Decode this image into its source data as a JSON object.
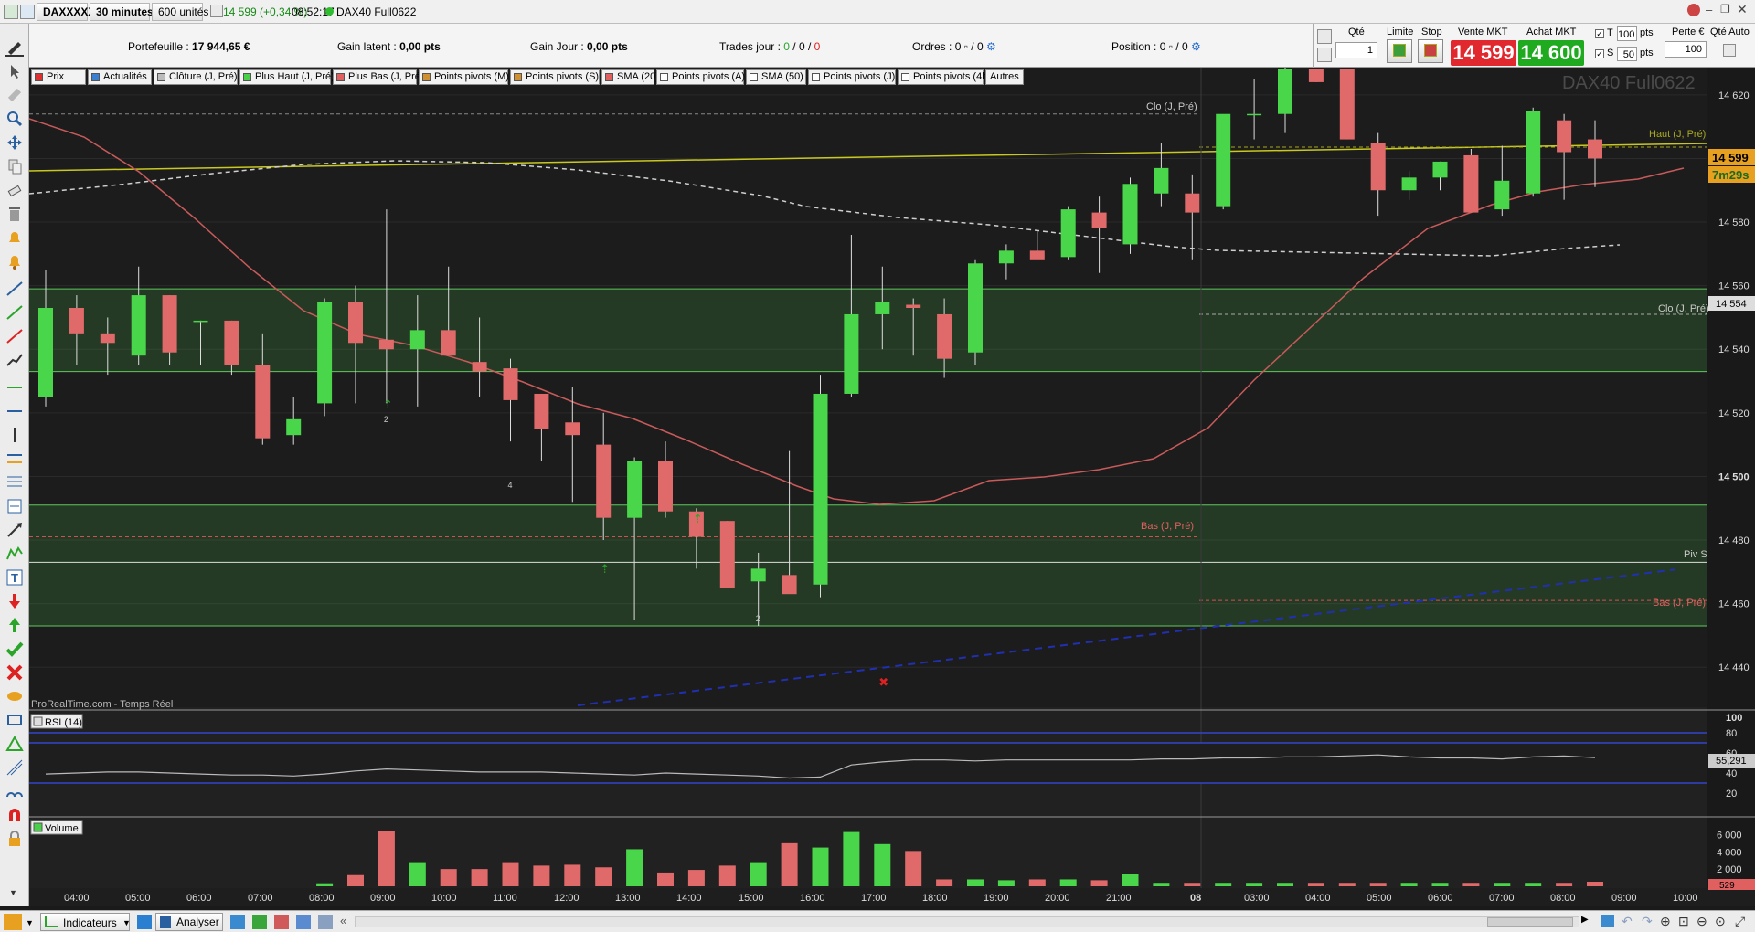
{
  "topbar": {
    "instrument": "DAXXXXX",
    "timeframe": "30 minutes",
    "units": "600 unités",
    "quote": "14 599 (+0,34 %)",
    "time": "08:52:17",
    "title": "DAX40 Full0622"
  },
  "infobar": {
    "portfolio_label": "Portefeuille :",
    "portfolio_value": "17 944,65 €",
    "gain_latent_label": "Gain latent :",
    "gain_latent_value": "0,00 pts",
    "gain_jour_label": "Gain Jour :",
    "gain_jour_value": "0,00 pts",
    "trades_label": "Trades jour :",
    "trades_a": "0",
    "trades_b": "0",
    "trades_c": "0",
    "ordres_label": "Ordres :",
    "ordres_a": "0",
    "ordres_b": "0",
    "position_label": "Position :",
    "position_a": "0",
    "position_b": "0"
  },
  "orderpanel": {
    "qte_label": "Qté",
    "qte_value": "1",
    "limite_label": "Limite",
    "stop_label": "Stop",
    "vente_label": "Vente MKT",
    "vente_price": "14 599",
    "achat_label": "Achat MKT",
    "achat_price": "14 600",
    "t_label": "T",
    "t_value": "100",
    "t_unit": "pts",
    "s_label": "S",
    "s_value": "50",
    "s_unit": "pts",
    "perte_label": "Perte €",
    "perte_value": "100",
    "qte_auto_label": "Qté Auto"
  },
  "chips": [
    {
      "label": "Prix",
      "color": "#e03030"
    },
    {
      "label": "Actualités",
      "color": "#3a7fd0"
    },
    {
      "label": "Clôture (J, Pré)",
      "color": "#bbbbbb"
    },
    {
      "label": "Plus Haut (J, Pré)",
      "color": "#49d049"
    },
    {
      "label": "Plus Bas (J, Pré)",
      "color": "#e06060"
    },
    {
      "label": "Points pivots (M)",
      "color": "#d09030"
    },
    {
      "label": "Points pivots (S)",
      "color": "#d09030"
    },
    {
      "label": "SMA (20)",
      "color": "#e06060"
    },
    {
      "label": "Points pivots (A)",
      "color": "#ffffff"
    },
    {
      "label": "SMA (50)",
      "color": "#ffffff"
    },
    {
      "label": "Points pivots (J)",
      "color": "#ffffff"
    },
    {
      "label": "Points pivots (4h)",
      "color": "#ffffff"
    },
    {
      "label": "Autres",
      "color": ""
    }
  ],
  "chart": {
    "watermark": "DAX40 Full0622",
    "source": "ProRealTime.com - Temps Réel",
    "price_ticks": [
      "14 620",
      "14 600",
      "14 580",
      "14 560",
      "14 540",
      "14 520",
      "14 500",
      "14 480",
      "14 460",
      "14 440"
    ],
    "current_price": "14 599",
    "countdown": "7m29s",
    "price_tag_2": "14 554",
    "line_labels": {
      "clo_top": "Clo (J, Pré)",
      "haut": "Haut (J, Pré)",
      "clo_right": "Clo (J, Pré)",
      "bas_mid": "Bas (J, Pré)",
      "piv": "Piv S",
      "bas_right": "Bas (J, Pré)"
    },
    "time_ticks": [
      "04:00",
      "05:00",
      "06:00",
      "07:00",
      "08:00",
      "09:00",
      "10:00",
      "11:00",
      "12:00",
      "13:00",
      "14:00",
      "15:00",
      "16:00",
      "17:00",
      "18:00",
      "19:00",
      "20:00",
      "21:00",
      "08",
      "03:00",
      "04:00",
      "05:00",
      "06:00",
      "07:00",
      "08:00",
      "09:00",
      "10:00"
    ],
    "markers": [
      "2",
      "4",
      "2"
    ]
  },
  "rsi": {
    "label": "RSI (14)",
    "ticks": [
      "100",
      "80",
      "60",
      "40",
      "20"
    ],
    "value": "55,291"
  },
  "volume": {
    "label": "Volume",
    "ticks": [
      "6 000",
      "4 000",
      "2 000"
    ],
    "last": "529"
  },
  "chart_data": {
    "type": "candlestick",
    "title": "DAX40 Full0622",
    "timeframe": "30 minutes",
    "ylim": [
      14425,
      14625
    ],
    "candles": [
      {
        "o": 14525,
        "h": 14565,
        "l": 14522,
        "c": 14553
      },
      {
        "o": 14553,
        "h": 14557,
        "l": 14535,
        "c": 14545
      },
      {
        "o": 14545,
        "h": 14550,
        "l": 14532,
        "c": 14542
      },
      {
        "o": 14538,
        "h": 14566,
        "l": 14535,
        "c": 14557
      },
      {
        "o": 14557,
        "h": 14557,
        "l": 14535,
        "c": 14539
      },
      {
        "o": 14549,
        "h": 14549,
        "l": 14535,
        "c": 14549
      },
      {
        "o": 14549,
        "h": 14549,
        "l": 14532,
        "c": 14535
      },
      {
        "o": 14535,
        "h": 14545,
        "l": 14510,
        "c": 14512
      },
      {
        "o": 14513,
        "h": 14525,
        "l": 14510,
        "c": 14518
      },
      {
        "o": 14523,
        "h": 14556,
        "l": 14519,
        "c": 14555
      },
      {
        "o": 14555,
        "h": 14560,
        "l": 14523,
        "c": 14542
      },
      {
        "o": 14543,
        "h": 14584,
        "l": 14523,
        "c": 14540
      },
      {
        "o": 14540,
        "h": 14557,
        "l": 14522,
        "c": 14546
      },
      {
        "o": 14546,
        "h": 14566,
        "l": 14539,
        "c": 14538
      },
      {
        "o": 14536,
        "h": 14550,
        "l": 14525,
        "c": 14533
      },
      {
        "o": 14534,
        "h": 14537,
        "l": 14511,
        "c": 14524
      },
      {
        "o": 14526,
        "h": 14526,
        "l": 14505,
        "c": 14515
      },
      {
        "o": 14517,
        "h": 14528,
        "l": 14492,
        "c": 14513
      },
      {
        "o": 14510,
        "h": 14520,
        "l": 14480,
        "c": 14487
      },
      {
        "o": 14487,
        "h": 14506,
        "l": 14455,
        "c": 14505
      },
      {
        "o": 14505,
        "h": 14511,
        "l": 14487,
        "c": 14489
      },
      {
        "o": 14489,
        "h": 14490,
        "l": 14471,
        "c": 14481
      },
      {
        "o": 14486,
        "h": 14486,
        "l": 14465,
        "c": 14465
      },
      {
        "o": 14467,
        "h": 14476,
        "l": 14453,
        "c": 14471
      },
      {
        "o": 14469,
        "h": 14508,
        "l": 14466,
        "c": 14463
      },
      {
        "o": 14466,
        "h": 14532,
        "l": 14462,
        "c": 14526
      },
      {
        "o": 14526,
        "h": 14576,
        "l": 14525,
        "c": 14551
      },
      {
        "o": 14551,
        "h": 14566,
        "l": 14540,
        "c": 14555
      },
      {
        "o": 14554,
        "h": 14556,
        "l": 14538,
        "c": 14553
      },
      {
        "o": 14551,
        "h": 14556,
        "l": 14531,
        "c": 14537
      },
      {
        "o": 14539,
        "h": 14568,
        "l": 14535,
        "c": 14567
      },
      {
        "o": 14567,
        "h": 14573,
        "l": 14562,
        "c": 14571
      },
      {
        "o": 14571,
        "h": 14577,
        "l": 14570,
        "c": 14568
      },
      {
        "o": 14569,
        "h": 14585,
        "l": 14568,
        "c": 14584
      },
      {
        "o": 14583,
        "h": 14588,
        "l": 14564,
        "c": 14578
      },
      {
        "o": 14573,
        "h": 14594,
        "l": 14570,
        "c": 14592
      },
      {
        "o": 14589,
        "h": 14605,
        "l": 14585,
        "c": 14597
      },
      {
        "o": 14589,
        "h": 14595,
        "l": 14568,
        "c": 14583
      },
      {
        "o": 14585,
        "h": 14612,
        "l": 14584,
        "c": 14614
      },
      {
        "o": 14614,
        "h": 14625,
        "l": 14606,
        "c": 14614
      },
      {
        "o": 14614,
        "h": 14630,
        "l": 14608,
        "c": 14628
      },
      {
        "o": 14628,
        "h": 14628,
        "l": 14624,
        "c": 14624
      },
      {
        "o": 14628,
        "h": 14628,
        "l": 14606,
        "c": 14606
      },
      {
        "o": 14605,
        "h": 14608,
        "l": 14582,
        "c": 14590
      },
      {
        "o": 14590,
        "h": 14596,
        "l": 14587,
        "c": 14594
      },
      {
        "o": 14594,
        "h": 14599,
        "l": 14590,
        "c": 14599
      },
      {
        "o": 14601,
        "h": 14603,
        "l": 14583,
        "c": 14583
      },
      {
        "o": 14584,
        "h": 14604,
        "l": 14582,
        "c": 14593
      },
      {
        "o": 14589,
        "h": 14616,
        "l": 14588,
        "c": 14615
      },
      {
        "o": 14612,
        "h": 14614,
        "l": 14587,
        "c": 14602
      },
      {
        "o": 14606,
        "h": 14612,
        "l": 14591,
        "c": 14600
      }
    ],
    "volume": [
      0,
      0,
      0,
      0,
      0,
      0,
      0,
      0,
      0,
      350,
      1300,
      6400,
      2800,
      2000,
      2000,
      2800,
      2400,
      2500,
      2200,
      4300,
      1600,
      1900,
      2400,
      2800,
      5000,
      4500,
      6300,
      4900,
      4100,
      800,
      800,
      700,
      800,
      800,
      700,
      1400,
      400,
      400,
      400,
      400,
      400,
      400,
      400,
      400,
      400,
      400,
      400,
      400,
      400,
      400,
      529
    ],
    "rsi": [
      39,
      40,
      41,
      41,
      40,
      39,
      38,
      38,
      37,
      39,
      42,
      44,
      43,
      42,
      41,
      41,
      41,
      40,
      39,
      38,
      40,
      39,
      38,
      37,
      35,
      36,
      48,
      51,
      53,
      53,
      52,
      53,
      53,
      53,
      53,
      53,
      54,
      54,
      55,
      55,
      56,
      56,
      57,
      58,
      56,
      55,
      55,
      54,
      56,
      57,
      55.291
    ],
    "rsi_levels": [
      80,
      70,
      30
    ],
    "haut_j_pre": 14603,
    "clo_j_pre": 14551,
    "bas_j_pre": 14481,
    "piv_s": 14473,
    "zones": [
      [
        14533,
        14559
      ],
      [
        14453,
        14491
      ]
    ]
  }
}
